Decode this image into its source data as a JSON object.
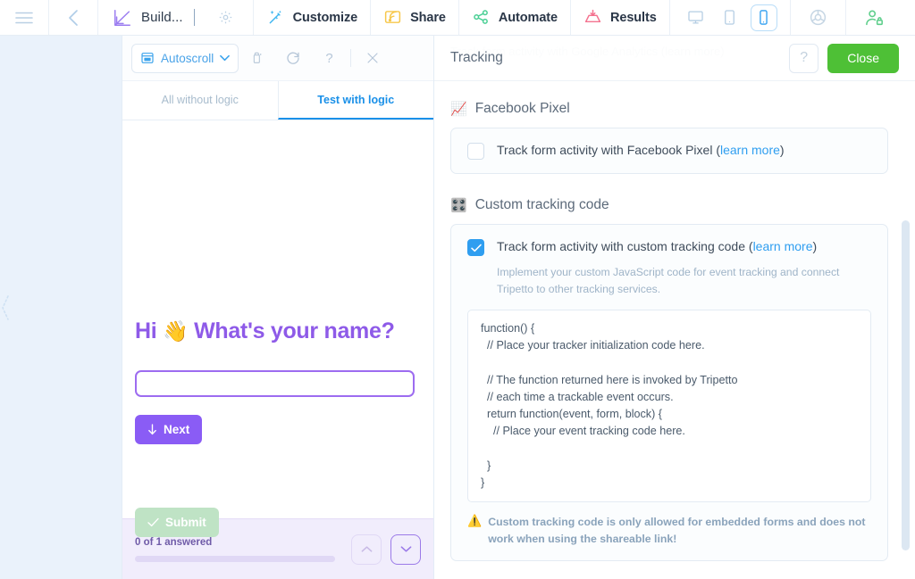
{
  "topbar": {
    "menu_icon": "hamburger-icon",
    "back_icon": "chevron-left-icon",
    "build_icon": "build-icon",
    "build_label": "Build...",
    "gear_icon": "gear-icon",
    "items": [
      {
        "label": "Customize",
        "icon": "wand-icon",
        "color": "#3fb6f0"
      },
      {
        "label": "Share",
        "icon": "share-cast-icon",
        "color": "#f7c74a"
      },
      {
        "label": "Automate",
        "icon": "automate-nodes-icon",
        "color": "#49cf94"
      },
      {
        "label": "Results",
        "icon": "results-inbox-icon",
        "color": "#f4728f"
      }
    ],
    "devices": [
      {
        "name": "desktop-view",
        "active": false
      },
      {
        "name": "tablet-view",
        "active": false
      },
      {
        "name": "mobile-view",
        "active": true
      }
    ],
    "theme_icon": "theme-donut-icon",
    "account_icon": "account-lock-icon"
  },
  "preview": {
    "toolbar": {
      "autoscroll_label": "Autoscroll",
      "autoscroll_icon": "autoscroll-icon",
      "chevron_icon": "chevron-down-icon",
      "buttons": [
        {
          "name": "pin-button",
          "icon": "pin-icon"
        },
        {
          "name": "restart-button",
          "icon": "refresh-icon"
        },
        {
          "name": "help-button",
          "icon": "question-icon"
        },
        {
          "name": "close-preview-button",
          "icon": "close-icon"
        }
      ]
    },
    "tabs": [
      {
        "label": "All without logic",
        "active": false
      },
      {
        "label": "Test with logic",
        "active": true
      }
    ],
    "form": {
      "greeting": "Hi",
      "wave_emoji": "👋",
      "question": "What's your name?",
      "answer_value": "",
      "next_label": "Next",
      "next_icon": "arrow-down-icon",
      "submit_label": "Submit",
      "submit_icon": "check-icon"
    },
    "footer": {
      "progress_label": "0 of 1 answered",
      "progress_percent": 0,
      "prev_icon": "chevron-up-icon",
      "next_icon": "chevron-down-icon"
    }
  },
  "panel": {
    "title": "Tracking",
    "help_label": "?",
    "close_label": "Close",
    "ghost_row_text": "Track form activity with Google Analytics (learn more)",
    "sections": [
      {
        "emoji": "📈",
        "icon": "chart-increasing-icon",
        "title": "Facebook Pixel",
        "option_label_prefix": "Track form activity with Facebook Pixel (",
        "option_link": "learn more",
        "option_label_suffix": ")",
        "checked": false
      },
      {
        "emoji": "🎛️",
        "icon": "control-knobs-icon",
        "title": "Custom tracking code",
        "option_label_prefix": "Track form activity with custom tracking code (",
        "option_link": "learn more",
        "option_label_suffix": ")",
        "checked": true,
        "description": "Implement your custom JavaScript code for event tracking and connect Tripetto to other tracking services.",
        "code": "function() {\n  // Place your tracker initialization code here.\n\n  // The function returned here is invoked by Tripetto\n  // each time a trackable event occurs.\n  return function(event, form, block) {\n    // Place your event tracking code here.\n\n  }\n}",
        "warning": "Custom tracking code is only allowed for embedded forms and does not work when using the shareable link!",
        "warning_icon": "warning-triangle-icon"
      }
    ]
  },
  "colors": {
    "accent_blue": "#2f9ef0",
    "purple": "#8a5cf5",
    "green": "#4ec036",
    "panel_bg": "#ffffff",
    "app_bg": "#eaf2fb"
  }
}
